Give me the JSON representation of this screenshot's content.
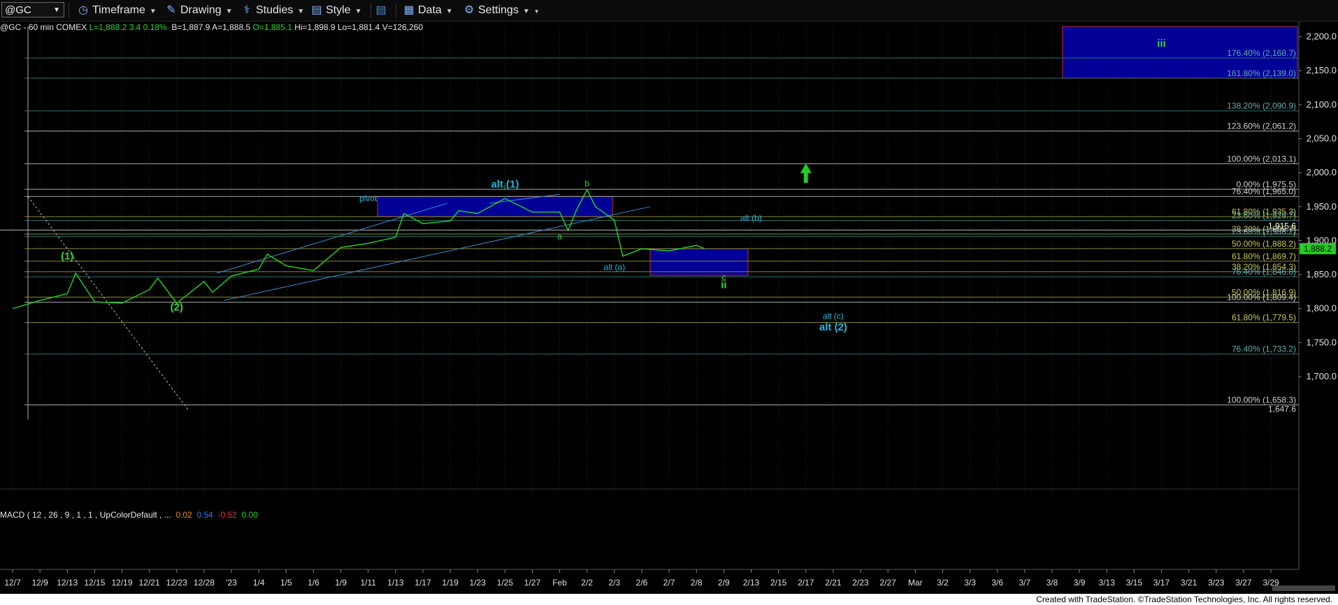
{
  "toolbar": {
    "symbol": "@GC",
    "timeframe": "Timeframe",
    "drawing": "Drawing",
    "studies": "Studies",
    "style": "Style",
    "data": "Data",
    "settings": "Settings"
  },
  "header": {
    "instrument": "@GC - 60 min  COMEX",
    "last": "L=1,888.2",
    "change": "3.4",
    "change_pct": "0.18%",
    "bid": "B=1,887.9",
    "ask": "A=1,888.5",
    "open": "O=1,885.1",
    "high": "Hi=1,898.9",
    "low": "Lo=1,881.4",
    "volume": "V=126,260"
  },
  "macd": {
    "label": "MACD ( 12 , 26 , 9 , 1 , 1 , UpColorDefault , ...",
    "v1": "0.02",
    "v2": "0.54",
    "v3": "-0.52",
    "v4": "0.00"
  },
  "footer": "Created with TradeStation. ©TradeStation Technologies, Inc. All rights reserved.",
  "colors": {
    "price_line": "#22d622",
    "grid": "#1f3a1f",
    "axis_text": "#e0e0e0",
    "fib_gray": "#aaaaaa",
    "fib_olive": "#8b8b3a",
    "fib_teal": "#2f6f6f",
    "box_blue": "#000096",
    "cyan_label": "#27b6d8",
    "green_label": "#3fd13f"
  },
  "chart_data": {
    "type": "line",
    "title": "@GC - 60 min",
    "y_ticks": [
      "2,200.0",
      "2,150.0",
      "2,100.0",
      "2,050.0",
      "2,000.0",
      "1,950.0",
      "1,900.0",
      "1,850.0",
      "1,800.0",
      "1,750.0",
      "1,700.0"
    ],
    "ylim": [
      1647.6,
      2215
    ],
    "x_ticks": [
      "12/7",
      "12/9",
      "12/13",
      "12/15",
      "12/19",
      "12/21",
      "12/23",
      "12/28",
      "'23",
      "1/4",
      "1/5",
      "1/6",
      "1/9",
      "1/11",
      "1/13",
      "1/17",
      "1/19",
      "1/23",
      "1/25",
      "1/27",
      "Feb",
      "2/2",
      "2/3",
      "2/6",
      "2/7",
      "2/8",
      "2/9",
      "2/13",
      "2/15",
      "2/17",
      "2/21",
      "2/23",
      "2/27",
      "Mar",
      "3/2",
      "3/3",
      "3/6",
      "3/7",
      "3/8",
      "3/9",
      "3/13",
      "3/15",
      "3/17",
      "3/21",
      "3/23",
      "3/27",
      "3/29"
    ],
    "last_price_tag": "1,888.2",
    "price_line_1915": "1,915.6",
    "bottom_partial_label": "1,647.6",
    "series": [
      {
        "name": "@GC 60 min",
        "points": [
          [
            "12/7",
            1800
          ],
          [
            "12/9",
            1812
          ],
          [
            "12/13",
            1822
          ],
          [
            "12/13",
            1852
          ],
          [
            "12/15",
            1810
          ],
          [
            "12/19",
            1808
          ],
          [
            "12/21",
            1828
          ],
          [
            "12/21",
            1845
          ],
          [
            "12/23",
            1808
          ],
          [
            "12/28",
            1840
          ],
          [
            "12/28",
            1824
          ],
          [
            "'23",
            1848
          ],
          [
            "1/4",
            1858
          ],
          [
            "1/4",
            1880
          ],
          [
            "1/5",
            1863
          ],
          [
            "1/6",
            1856
          ],
          [
            "1/9",
            1890
          ],
          [
            "1/11",
            1896
          ],
          [
            "1/13",
            1905
          ],
          [
            "1/13",
            1940
          ],
          [
            "1/17",
            1925
          ],
          [
            "1/19",
            1929
          ],
          [
            "1/19",
            1944
          ],
          [
            "1/23",
            1940
          ],
          [
            "1/25",
            1962
          ],
          [
            "1/27",
            1942
          ],
          [
            "Feb",
            1942
          ],
          [
            "Feb",
            1915
          ],
          [
            "Feb",
            1945
          ],
          [
            "2/2",
            1975
          ],
          [
            "2/2",
            1950
          ],
          [
            "2/3",
            1930
          ],
          [
            "2/3",
            1877
          ],
          [
            "2/6",
            1888
          ],
          [
            "2/7",
            1885
          ],
          [
            "2/8",
            1893
          ],
          [
            "2/8",
            1888
          ]
        ]
      }
    ],
    "fib_levels": [
      {
        "label": "176.40% (2,168.7)",
        "value": 2168.7
      },
      {
        "label": "161.80% (2,139.0)",
        "value": 2139.0
      },
      {
        "label": "138.20% (2,090.9)",
        "value": 2090.9
      },
      {
        "label": "123.60% (2,061.2)",
        "value": 2061.2
      },
      {
        "label": "100.00% (2,013.1)",
        "value": 2013.1
      },
      {
        "label": "0.00% (1,975.5)",
        "value": 1975.5
      },
      {
        "label": "76.40% (1,965.0)",
        "value": 1965.0
      },
      {
        "label": "61.80% (1,935.3)",
        "value": 1935.3
      },
      {
        "label": "23.60% (1,929.7)",
        "value": 1929.7
      },
      {
        "label": "38.20% (1,909.7)",
        "value": 1909.7
      },
      {
        "label": "23.60% (1,906.2)",
        "value": 1906.2
      },
      {
        "label": "50.00% (1,888.2)",
        "value": 1888.2
      },
      {
        "label": "61.80% (1,869.7)",
        "value": 1869.7
      },
      {
        "label": "38.20% (1,854.3)",
        "value": 1854.3
      },
      {
        "label": "76.40% (1,846.8)",
        "value": 1846.8
      },
      {
        "label": "50.00% (1,816.9)",
        "value": 1816.9
      },
      {
        "label": "100.00% (1,809.4)",
        "value": 1809.4
      },
      {
        "label": "61.80% (1,779.5)",
        "value": 1779.5
      },
      {
        "label": "76.40% (1,733.2)",
        "value": 1733.2
      },
      {
        "label": "100.00% (1,658.3)",
        "value": 1658.3
      }
    ],
    "wave_labels": [
      {
        "text": "(1)",
        "x": "12/13",
        "y": 1872,
        "color": "green"
      },
      {
        "text": "(2)",
        "x": "12/23",
        "y": 1797,
        "color": "green"
      },
      {
        "text": "alt (1)",
        "x": "1/25",
        "y": 1978,
        "color": "cyan"
      },
      {
        "text": "i",
        "x": "1/25",
        "y": 1975,
        "color": "green"
      },
      {
        "text": "pivot",
        "x": "1/11",
        "y": 1958,
        "color": "cyan"
      },
      {
        "text": "a",
        "x": "Feb",
        "y": 1902,
        "color": "green"
      },
      {
        "text": "b",
        "x": "2/2",
        "y": 1980,
        "color": "green"
      },
      {
        "text": "alt (b)",
        "x": "2/13",
        "y": 1929,
        "color": "cyan"
      },
      {
        "text": "alt (a)",
        "x": "2/3",
        "y": 1857,
        "color": "cyan"
      },
      {
        "text": "c",
        "x": "2/9",
        "y": 1842,
        "color": "green"
      },
      {
        "text": "ii",
        "x": "2/9",
        "y": 1830,
        "color": "green"
      },
      {
        "text": "alt (c)",
        "x": "2/21",
        "y": 1785,
        "color": "cyan"
      },
      {
        "text": "alt (2)",
        "x": "2/21",
        "y": 1768,
        "color": "cyan"
      },
      {
        "text": "iii",
        "x": "3/17",
        "y": 2185,
        "color": "green"
      }
    ]
  }
}
